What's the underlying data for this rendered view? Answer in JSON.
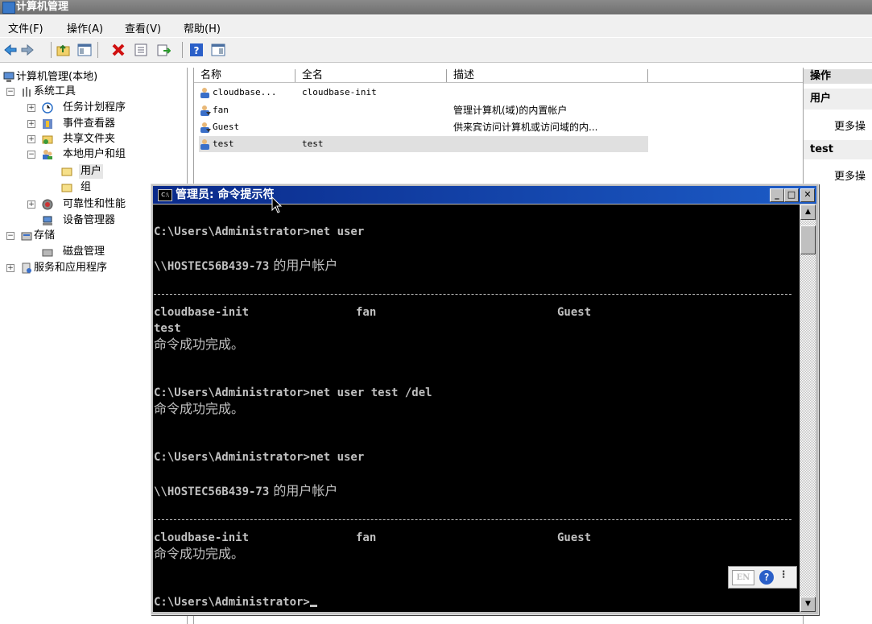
{
  "window": {
    "title": "计算机管理"
  },
  "menu": [
    "文件(F)",
    "操作(A)",
    "查看(V)",
    "帮助(H)"
  ],
  "tree": {
    "root": "计算机管理(本地)",
    "system_tools": "系统工具",
    "task_scheduler": "任务计划程序",
    "event_viewer": "事件查看器",
    "shared_folders": "共享文件夹",
    "local_users": "本地用户和组",
    "users": "用户",
    "groups": "组",
    "reliability": "可靠性和性能",
    "device_manager": "设备管理器",
    "storage": "存储",
    "disk_management": "磁盘管理",
    "services_apps": "服务和应用程序"
  },
  "list": {
    "columns": [
      "名称",
      "全名",
      "描述"
    ],
    "rows": [
      {
        "name": "cloudbase...",
        "fullname": "cloudbase-init",
        "desc": ""
      },
      {
        "name": "fan",
        "fullname": "",
        "desc": "管理计算机(域)的内置帐户"
      },
      {
        "name": "Guest",
        "fullname": "",
        "desc": "供来宾访问计算机或访问域的内..."
      },
      {
        "name": "test",
        "fullname": "test",
        "desc": ""
      }
    ]
  },
  "actions": {
    "header": "操作",
    "section1": "用户",
    "more1": "更多操",
    "section2": "test",
    "more2": "更多操"
  },
  "cmd": {
    "title": "管理员: 命令提示符",
    "prompt1": "C:\\Users\\Administrator>net user",
    "accounts_header1": "\\\\HOSTEC56B439-73",
    "accounts_header1_cn": " 的用户帐户",
    "users1_a": "cloudbase-init",
    "users1_b": "fan",
    "users1_c": "Guest",
    "users1_d": "test",
    "done1": "命令成功完成。",
    "prompt2": "C:\\Users\\Administrator>net user test /del",
    "done2": "命令成功完成。",
    "prompt3": "C:\\Users\\Administrator>net user",
    "accounts_header2": "\\\\HOSTEC56B439-73",
    "accounts_header2_cn": " 的用户帐户",
    "users2_a": "cloudbase-init",
    "users2_b": "fan",
    "users2_c": "Guest",
    "done3": "命令成功完成。",
    "prompt4": "C:\\Users\\Administrator>",
    "ime_lang": "EN"
  }
}
